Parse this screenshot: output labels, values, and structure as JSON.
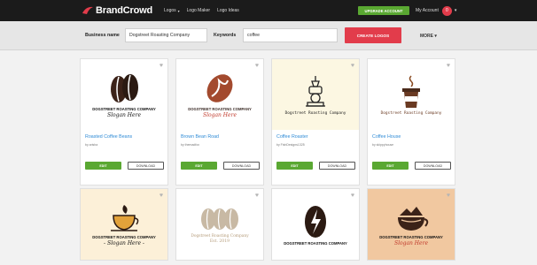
{
  "header": {
    "brand": "BrandCrowd",
    "nav": [
      {
        "label": "Logos",
        "caret": "▾"
      },
      {
        "label": "Logo Maker"
      },
      {
        "label": "Logo Ideas"
      }
    ],
    "upgrade_label": "UPGRADE ACCOUNT",
    "account_label": "My Account",
    "account_badge": "0"
  },
  "search": {
    "business_label": "Business name",
    "business_value": "Dogstreet Roasting Company",
    "keywords_label": "Keywords",
    "keywords_value": "coffee",
    "create_label": "CREATE LOGOS",
    "more_label": "MORE ▾"
  },
  "cards": [
    {
      "company": "DOGSTREET ROASTING COMPANY",
      "slogan": "Slogan Here",
      "title": "Roasted Coffee Beans",
      "by": "by arisha",
      "bg": "#ffffff"
    },
    {
      "company": "DOGSTREET ROASTING COMPANY",
      "slogan": "Slogan Here",
      "title": "Brown Bean Road",
      "by": "by themadfox",
      "bg": "#ffffff"
    },
    {
      "company": "Dogstreet Roasting Company",
      "title": "Coffee Roaster",
      "by": "by FishDesigns1325",
      "bg": "#fcf7e2"
    },
    {
      "company": "Dogstreet Roasting Company",
      "title": "Coffee House",
      "by": "by skippyhouse",
      "bg": "#ffffff"
    },
    {
      "company": "DOGSTREET ROASTING COMPANY",
      "slogan": "- Slogan Here -",
      "bg": "#fcf0d8"
    },
    {
      "company": "Dogstreet Roasting Company",
      "slogan": "Est. 2019",
      "bg": "#ffffff"
    },
    {
      "company": "DOGSTREET ROASTING COMPANY",
      "bg": "#ffffff"
    },
    {
      "company": "DOGSTREET ROASTING COMPANY",
      "slogan": "Slogan Here",
      "bg": "#f1c8a0"
    }
  ],
  "labels": {
    "edit": "EDIT",
    "download": "DOWNLOAD"
  }
}
